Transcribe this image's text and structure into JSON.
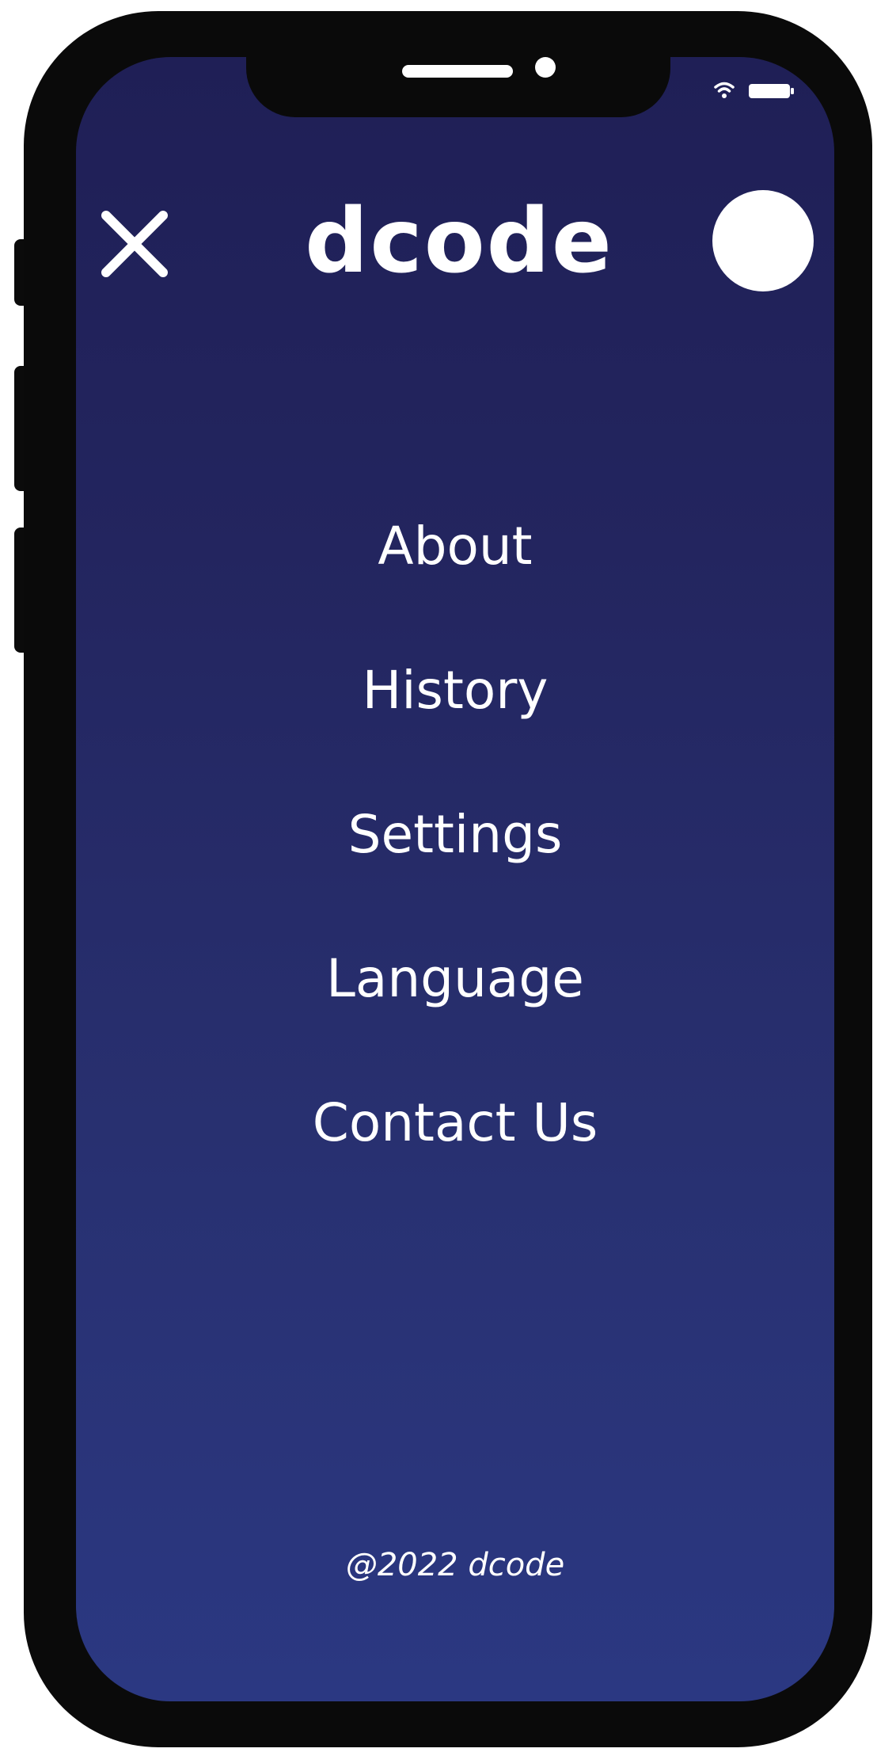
{
  "header": {
    "brand": "dcode",
    "close_icon": "close-icon",
    "avatar_icon": "avatar"
  },
  "status_bar": {
    "icons": [
      "wifi-icon",
      "battery-icon"
    ]
  },
  "menu": {
    "items": [
      {
        "label": "About"
      },
      {
        "label": "History"
      },
      {
        "label": "Settings"
      },
      {
        "label": "Language"
      },
      {
        "label": "Contact Us"
      }
    ]
  },
  "footer": {
    "text": "@2022 dcode"
  },
  "colors": {
    "background_top": "#1f1f56",
    "background_bottom": "#2b3882",
    "frame": "#0a0a0a",
    "text": "#ffffff"
  }
}
